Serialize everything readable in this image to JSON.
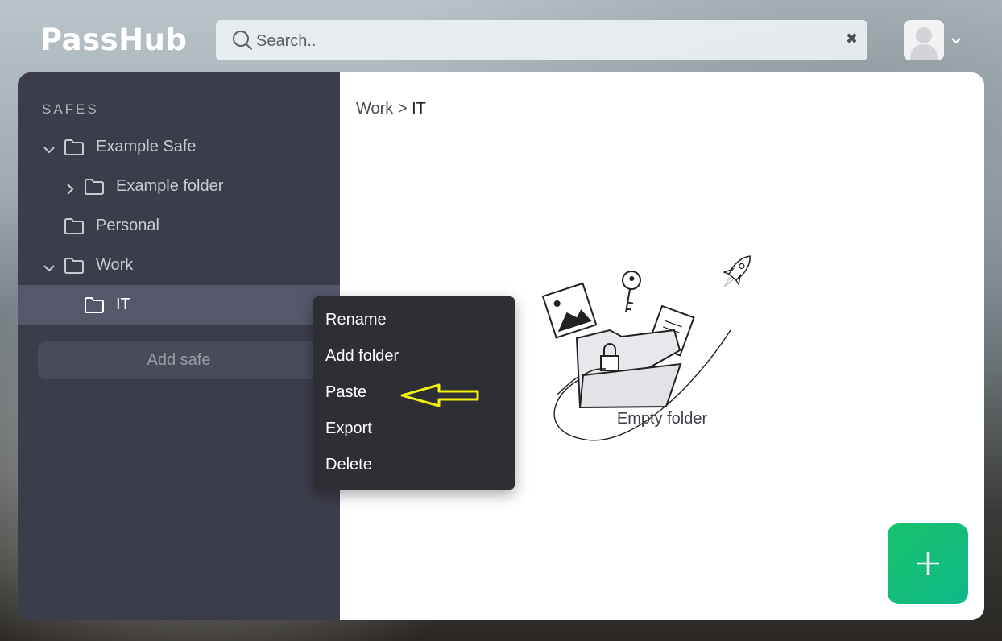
{
  "header": {
    "logo": "PassHub",
    "search_placeholder": "Search..",
    "clear_icon": "✖"
  },
  "sidebar": {
    "section_label": "SAFES",
    "items": [
      {
        "label": "Example Safe",
        "expanded": true
      },
      {
        "label": "Example folder",
        "expanded": false
      },
      {
        "label": "Personal"
      },
      {
        "label": "Work",
        "expanded": true
      },
      {
        "label": "IT",
        "active": true
      }
    ],
    "add_safe_label": "Add safe"
  },
  "main": {
    "breadcrumb_parent": "Work",
    "breadcrumb_separator": ">",
    "breadcrumb_current": "IT",
    "empty_text": "Empty folder"
  },
  "context_menu": {
    "items": [
      "Rename",
      "Add folder",
      "Paste",
      "Export",
      "Delete"
    ]
  },
  "colors": {
    "sidebar_bg": "#3c3d4a",
    "sidebar_active": "#55576a",
    "menu_bg": "#2e2f34",
    "fab_green": "#16c26a",
    "arrow_yellow": "#f2f20a"
  },
  "icons": [
    "search-icon",
    "clear-icon",
    "user-avatar-icon",
    "chevron-down-icon",
    "folder-icon",
    "chevron-right-icon",
    "plus-icon",
    "arrow-left-icon"
  ]
}
